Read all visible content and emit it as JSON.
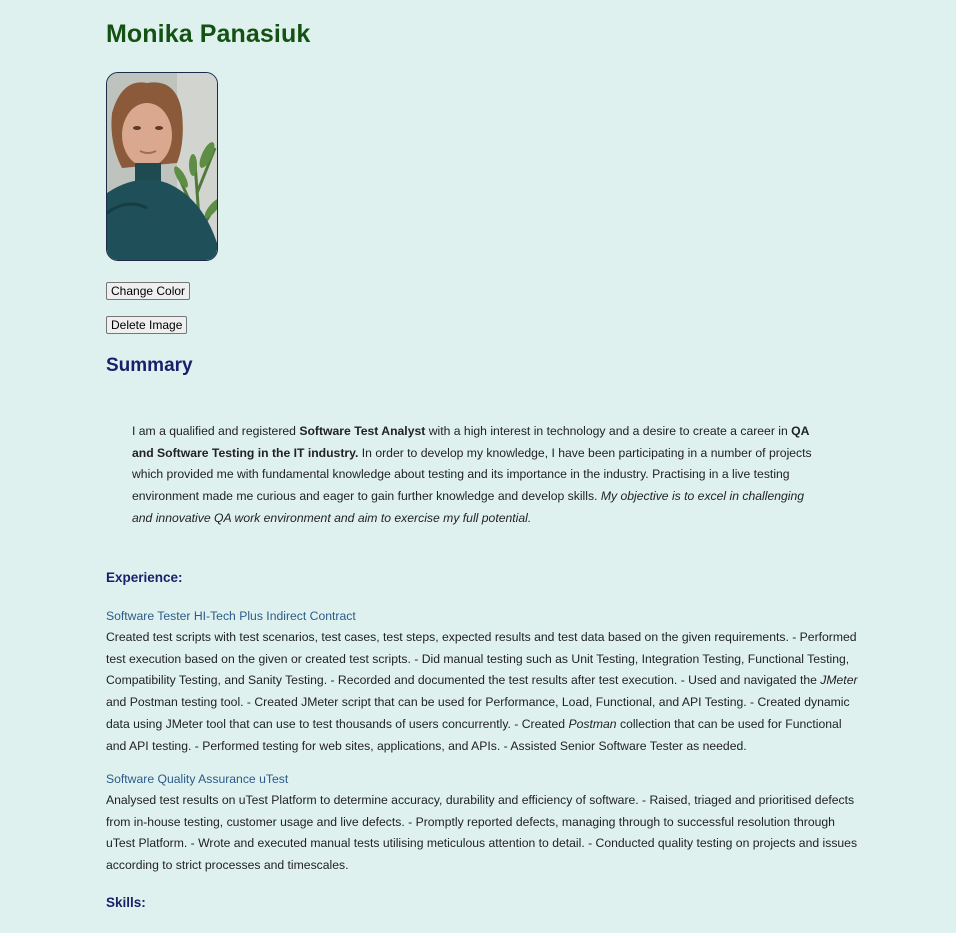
{
  "header": {
    "name": "Monika Panasiuk"
  },
  "profile": {
    "photo_alt": "Portrait photo"
  },
  "buttons": {
    "change_color": "Change Color",
    "delete_image": "Delete Image"
  },
  "summary": {
    "heading": "Summary",
    "p1": "I am a qualified and registered ",
    "b1": "Software Test Analyst",
    "p2": " with a high interest in technology and a desire to create a career in ",
    "b2": "QA and Software Testing in the IT industry.",
    "p3": " In order to develop my knowledge, I have been participating in a number of projects which provided me with fundamental knowledge about testing and its importance in the industry. Practising in a live testing environment made me curious and eager to gain further knowledge and develop skills. ",
    "i1": "My objective is to excel in challenging and innovative QA work environment and aim to exercise my full potential."
  },
  "experience": {
    "heading": "Experience:",
    "jobs": [
      {
        "title": "Software Tester HI-Tech Plus Indirect Contract",
        "d1": "Created test scripts with test scenarios, test cases, test steps, expected results and test data based on the given requirements. - Performed test execution based on the given or created test scripts. - Did manual testing such as Unit Testing, Integration Testing, Functional Testing, Compatibility Testing, and Sanity Testing. - Recorded and documented the test results after test execution. - Used and navigated the ",
        "i1": "JMeter",
        "d2": " and Postman testing tool. - Created JMeter script that can be used for Performance, Load, Functional, and API Testing. - Created dynamic data using JMeter tool that can use to test thousands of users concurrently. - Created ",
        "i2": "Postman",
        "d3": " collection that can be used for Functional and API testing. - Performed testing for web sites, applications, and APIs. - Assisted Senior Software Tester as needed."
      },
      {
        "title": "Software Quality Assurance uTest",
        "d1": "Analysed test results on uTest Platform to determine accuracy, durability and efficiency of software. - Raised, triaged and prioritised defects from in-house testing, customer usage and live defects. - Promptly reported defects, managing through to successful resolution through uTest Platform. - Wrote and executed manual tests utilising meticulous attention to detail. - Conducted quality testing on projects and issues according to strict processes and timescales."
      }
    ]
  },
  "skills": {
    "heading": "Skills:"
  }
}
